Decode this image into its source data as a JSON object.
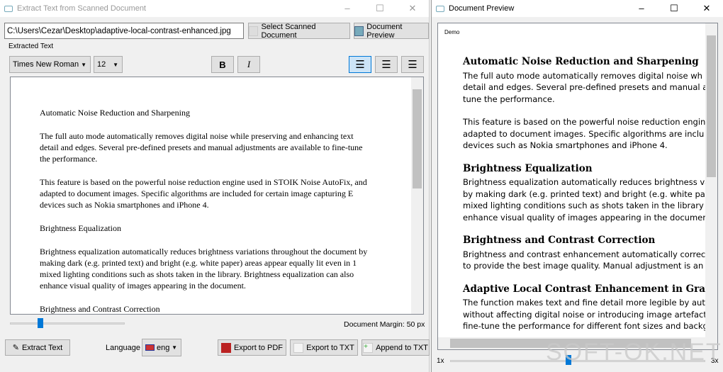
{
  "main_window": {
    "title": "Extract Text from Scanned Document",
    "file_path": "C:\\Users\\Cezar\\Desktop\\adaptive-local-contrast-enhanced.jpg",
    "select_button": "Select Scanned Document",
    "preview_button": "Document Preview",
    "group_label": "Extracted Text",
    "font": "Times New Roman",
    "size": "12",
    "bold": "B",
    "italic": "I",
    "paragraphs": [
      "Automatic Noise Reduction and Sharpening",
      "The full auto mode automatically removes digital noise while preserving and enhancing text detail and edges. Several pre-defined presets and manual adjustments are available to fine-tune the performance.",
      "This feature is based on the powerful noise reduction engine used in STOIK Noise AutoFix, and adapted to document images. Specific algorithms are included for certain image capturing E devices such as Nokia smartphones and iPhone 4.",
      "Brightness Equalization",
      "Brightness equalization automatically reduces brightness variations throughout the document by making dark (e.g. printed text) and bright (e.g. white paper) areas appear equally lit even in 1 mixed lighting conditions such as shots taken in the library. Brightness equalization can also enhance visual quality of images appearing in the document.",
      "Brightness and Contrast Correction"
    ],
    "margin_label": "Document Margin: 50 px",
    "margin_value": 50,
    "extract_button": "Extract Text",
    "language_label": "Language",
    "language": "eng",
    "export_pdf": "Export to PDF",
    "export_txt": "Export to TXT",
    "append_txt": "Append to TXT"
  },
  "preview_window": {
    "title": "Document Preview",
    "demo_label": "Demo",
    "sections": [
      {
        "heading": "Automatic Noise Reduction and Sharpening",
        "paras": [
          "The full auto mode automatically removes digital noise wh\ndetail and edges. Several pre-defined presets and manual a\ntune the performance.",
          "This feature is based on the powerful noise reduction engine\nadapted to document images. Specific algorithms are inclu\ndevices such as Nokia smartphones and iPhone 4."
        ]
      },
      {
        "heading": "Brightness Equalization",
        "paras": [
          "Brightness equalization automatically reduces brightness va\nby making dark (e.g. printed text) and bright (e.g. white pape\nmixed lighting conditions such as shots taken in the library\nenhance visual quality of images appearing in the document."
        ]
      },
      {
        "heading": "Brightness and Contrast Correction",
        "paras": [
          "Brightness and contrast enhancement automatically corrects\nto provide the best image quality. Manual adjustment is an op"
        ]
      },
      {
        "heading": "Adaptive Local Contrast Enhancement in Grayscale",
        "paras": [
          "The function makes text and fine detail more legible by auto\nwithout affecting digital noise or introducing image artefacts\nfine-tune the performance for different font sizes and backgr"
        ]
      }
    ],
    "zoom_min": "1x",
    "zoom_max": "3x",
    "zoom_value": 2
  },
  "watermark": "SOFT-OK.NET"
}
